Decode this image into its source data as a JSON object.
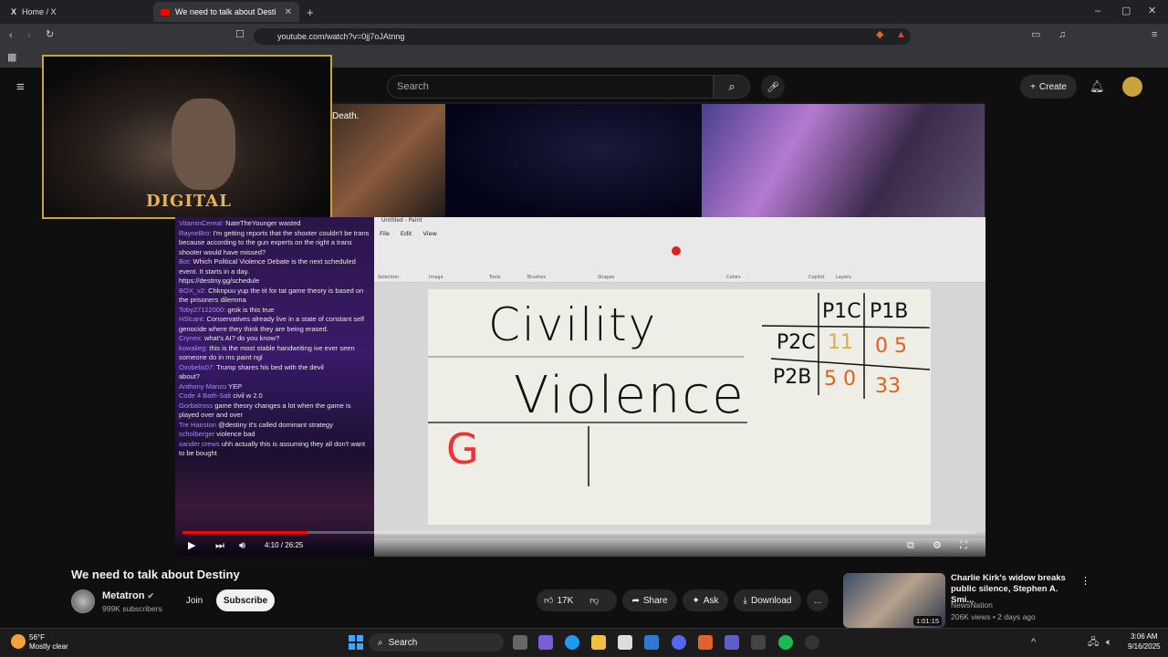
{
  "browser": {
    "tabs": [
      {
        "label": "Home / X"
      },
      {
        "label": "We need to talk about Destin"
      }
    ],
    "url": "youtube.com/watch?v=0jj7oJAtnng"
  },
  "youtube": {
    "search_placeholder": "Search",
    "create_label": "Create"
  },
  "video": {
    "overlay_death": "Death.",
    "webcam_brand": "DIGITAL",
    "time": "4:10 / 26:25",
    "progress_fraction": 0.157,
    "chat": [
      {
        "user": "VitaminCereal:",
        "text": "NateTheYounger wasted"
      },
      {
        "user": "RayneBro:",
        "text": "I'm getting reports that the shooter couldn't be trans because according to the gun experts on the right a trans shooter would have missed?"
      },
      {
        "user": "Bot:",
        "text": "Which Political Violence Debate is the next scheduled event. It starts in a day."
      },
      {
        "user": "",
        "text": "https://destiny.gg/schedule"
      },
      {
        "user": "BOX_v2:",
        "text": "Chknpuu yup the tit for tat game theory is based on the prisoners dilemma"
      },
      {
        "user": "Toby27122000:",
        "text": "grok is this true"
      },
      {
        "user": "HSlcant:",
        "text": "Conservatives already live in a state of constant self genocide where they think they are being erased."
      },
      {
        "user": "Crynex:",
        "text": "what's AI? do you know?"
      },
      {
        "user": "kowalieg:",
        "text": "this is the most stable handwriting ive ever seen someone do in ms paint ngl"
      },
      {
        "user": "Oxvbelis07:",
        "text": "Trump shares his bed with the devil"
      },
      {
        "user": "",
        "text": "about?"
      },
      {
        "user": "Anthony Manzo",
        "text": "YEP"
      },
      {
        "user": "Code 4 Bath-Salt",
        "text": "civil w 2.0"
      },
      {
        "user": "Gorbatross",
        "text": "game theory changes a lot when the game is played over and over"
      },
      {
        "user": "Tre Hairston",
        "text": "@destiny it's called dominant strategy"
      },
      {
        "user": "scholberger",
        "text": "violence bad"
      },
      {
        "user": "xander crews",
        "text": "uhh actually this is assuming they all don't want to be bought"
      }
    ],
    "paint": {
      "window_title": "Untitled - Paint",
      "menu": [
        "File",
        "Edit",
        "View"
      ],
      "groups": [
        "Selection",
        "Image",
        "Tools",
        "Brushes",
        "Shapes",
        "Colors",
        "Copilot",
        "Layers"
      ],
      "words": [
        "Civility",
        "Violence",
        "G"
      ],
      "matrix": {
        "col_headers": [
          "P1C",
          "P1B"
        ],
        "rows": [
          {
            "label": "P2C",
            "cells": [
              "11",
              "0 5"
            ]
          },
          {
            "label": "P2B",
            "cells": [
              "5 0",
              "33"
            ]
          }
        ]
      }
    }
  },
  "meta": {
    "title": "We need to talk about Destiny",
    "channel": "Metatron",
    "subscribers": "999K subscribers",
    "join": "Join",
    "subscribe": "Subscribe",
    "likes": "17K",
    "share": "Share",
    "ask": "Ask",
    "download": "Download",
    "more": "..."
  },
  "recommended": {
    "title": "Charlie Kirk's widow breaks public silence, Stephen A. Smi...",
    "channel": "NewsNation",
    "views": "206K views • 2 days ago",
    "duration": "1:01:15"
  },
  "taskbar": {
    "weather_temp": "56°F",
    "weather_desc": "Mostly clear",
    "search": "Search",
    "time": "3:06 AM",
    "date": "9/16/2025"
  },
  "colors": {
    "youtube_red": "#ff0000",
    "webcam_frame": "#c9a33b",
    "chat_purple": "#3a1a6a"
  }
}
